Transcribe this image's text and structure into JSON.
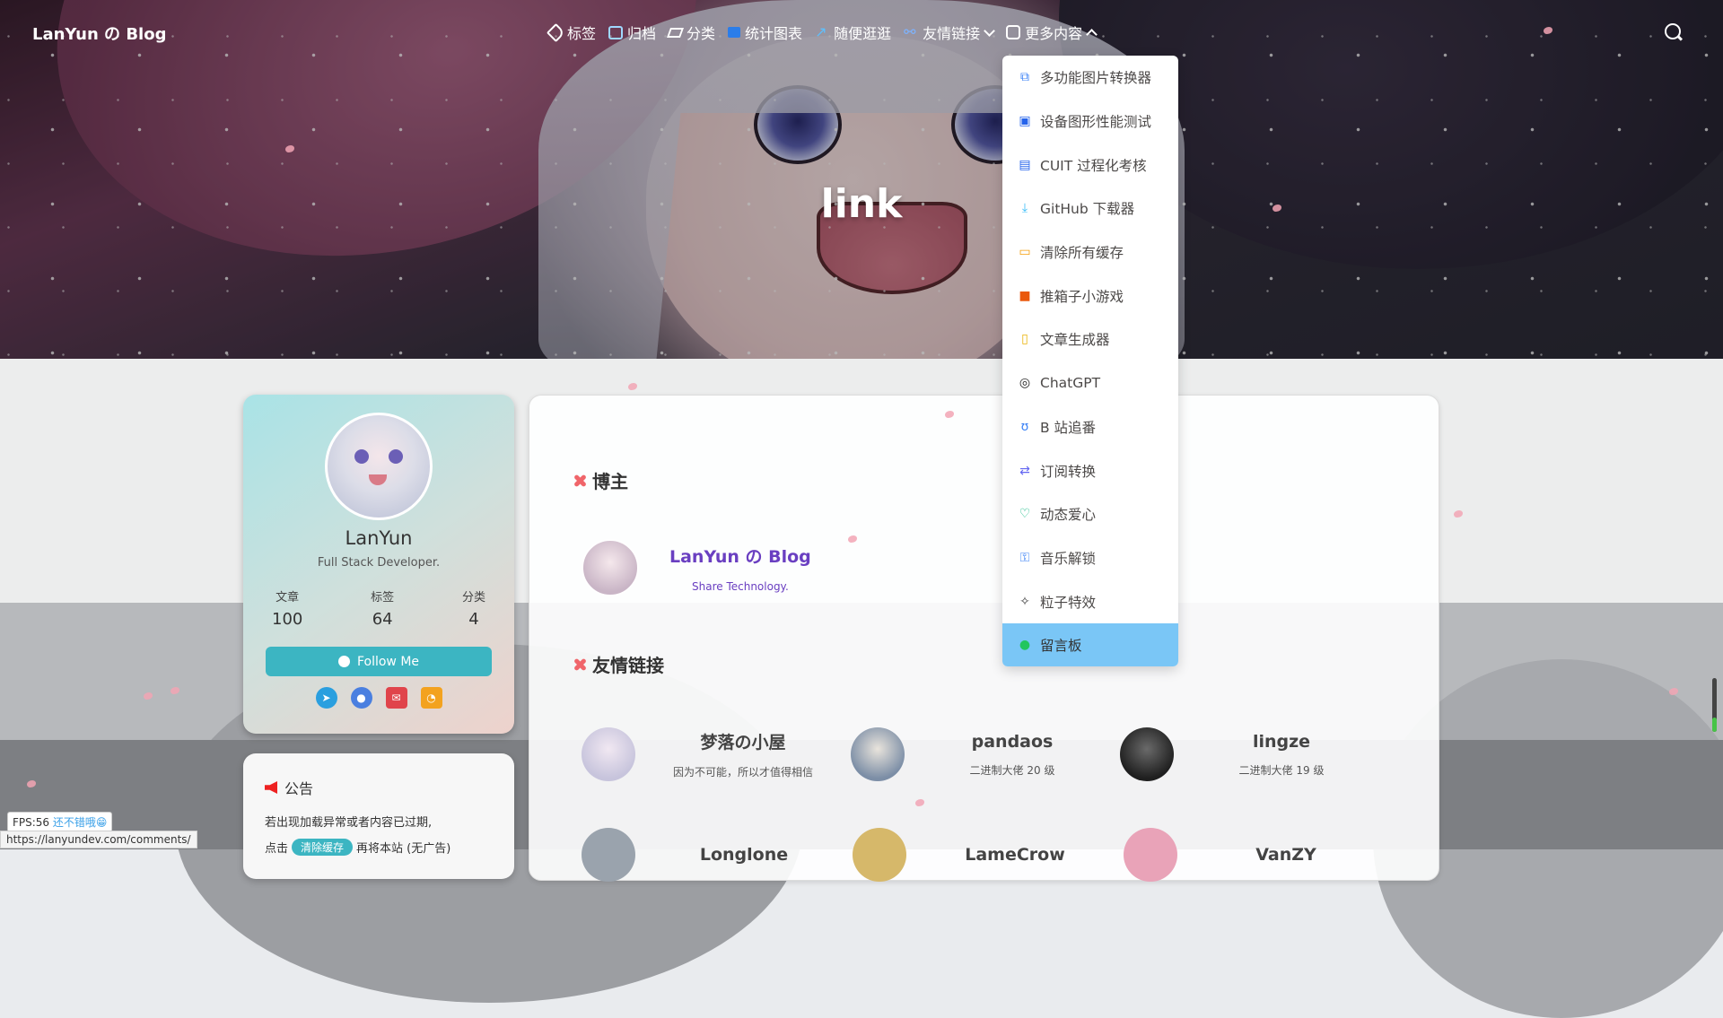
{
  "site": {
    "brand": "LanYun の Blog",
    "page_title": "link"
  },
  "nav": {
    "items": [
      {
        "label": "标签",
        "icon": "tag-icon"
      },
      {
        "label": "归档",
        "icon": "archive-icon"
      },
      {
        "label": "分类",
        "icon": "layers-icon"
      },
      {
        "label": "统计图表",
        "icon": "chart-icon"
      },
      {
        "label": "随便逛逛",
        "icon": "walk-icon"
      },
      {
        "label": "友情链接",
        "icon": "link-icon",
        "has_dropdown": true
      },
      {
        "label": "更多内容",
        "icon": "more-icon",
        "has_dropdown": true,
        "open": true
      }
    ],
    "search_icon": "search-icon"
  },
  "dropdown": {
    "items": [
      {
        "label": "多功能图片转换器",
        "icon": "image-convert-icon",
        "color": "#3b82f6"
      },
      {
        "label": "设备图形性能测试",
        "icon": "chip-icon",
        "color": "#2563eb"
      },
      {
        "label": "CUIT 过程化考核",
        "icon": "doc-icon",
        "color": "#2563eb"
      },
      {
        "label": "GitHub 下载器",
        "icon": "download-icon",
        "color": "#38bdf8"
      },
      {
        "label": "清除所有缓存",
        "icon": "basket-icon",
        "color": "#f59e0b"
      },
      {
        "label": "推箱子小游戏",
        "icon": "box-icon",
        "color": "#ea580c"
      },
      {
        "label": "文章生成器",
        "icon": "cup-icon",
        "color": "#eab308"
      },
      {
        "label": "ChatGPT",
        "icon": "chat-icon",
        "color": "#222222"
      },
      {
        "label": "B 站追番",
        "icon": "bilibili-icon",
        "color": "#3b82f6"
      },
      {
        "label": "订阅转换",
        "icon": "swap-icon",
        "color": "#6366f1"
      },
      {
        "label": "动态爱心",
        "icon": "heart-icon",
        "color": "#10b981"
      },
      {
        "label": "音乐解锁",
        "icon": "unlock-icon",
        "color": "#3b82f6"
      },
      {
        "label": "粒子特效",
        "icon": "sparkle-icon",
        "color": "#444444"
      },
      {
        "label": "留言板",
        "icon": "message-icon",
        "color": "#22c55e",
        "active": true
      }
    ]
  },
  "profile": {
    "name": "LanYun",
    "description": "Full Stack Developer.",
    "stats": [
      {
        "label": "文章",
        "value": "100"
      },
      {
        "label": "标签",
        "value": "64"
      },
      {
        "label": "分类",
        "value": "4"
      }
    ],
    "follow_label": "Follow Me",
    "socials": [
      "telegram-icon",
      "github-icon",
      "mail-icon",
      "rss-icon"
    ]
  },
  "notice": {
    "title": "公告",
    "line1": "若出现加载异常或者内容已过期,",
    "line2_prefix": "点击",
    "button": "清除缓存",
    "line2_suffix": "再将本站 (无广告)"
  },
  "blogger_section": {
    "heading": "博主",
    "blog_name": "LanYun の Blog",
    "tagline": "Share Technology."
  },
  "friends_section": {
    "heading": "友情链接",
    "row1": [
      {
        "name": "梦落の小屋",
        "desc": "因为不可能，所以才值得相信"
      },
      {
        "name": "pandaos",
        "desc": "二进制大佬 20 级"
      },
      {
        "name": "lingze",
        "desc": "二进制大佬 19 级"
      }
    ],
    "row2": [
      {
        "name": "Longlone"
      },
      {
        "name": "LameCrow"
      },
      {
        "name": "VanZY"
      }
    ]
  },
  "status": {
    "fps_label": "FPS:56",
    "fps_comment": "还不错哦😁",
    "hover_url": "https://lanyundev.com/comments/"
  }
}
